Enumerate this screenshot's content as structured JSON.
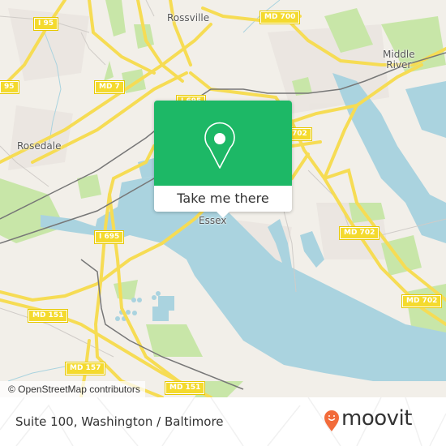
{
  "map": {
    "places": [
      {
        "name": "Rossville",
        "id": "rossville"
      },
      {
        "name": "Middle\nRiver",
        "id": "middle-river"
      },
      {
        "name": "Rosedale",
        "id": "rosedale"
      },
      {
        "name": "Essex",
        "id": "essex"
      }
    ],
    "road_shields": [
      {
        "label": "I 95",
        "id": "i95-north"
      },
      {
        "label": "95",
        "id": "i95-west"
      },
      {
        "label": "MD 7",
        "id": "md7"
      },
      {
        "label": "MD 700",
        "id": "md700"
      },
      {
        "label": "I 695",
        "id": "i695-top"
      },
      {
        "label": "702",
        "id": "md702-partial"
      },
      {
        "label": "I 695",
        "id": "i695"
      },
      {
        "label": "MD 702",
        "id": "md702-a"
      },
      {
        "label": "MD 702",
        "id": "md702-b"
      },
      {
        "label": "MD 151",
        "id": "md151-a"
      },
      {
        "label": "MD 157",
        "id": "md157"
      },
      {
        "label": "MD 151",
        "id": "md151-b"
      }
    ],
    "attribution": "© OpenStreetMap contributors",
    "colors": {
      "land": "#f2efe9",
      "water": "#aad3df",
      "park": "#c8e6a8",
      "road": "#f6dc54",
      "rail": "#777777",
      "popup_green": "#1db866",
      "brand_orange": "#f26b3a"
    }
  },
  "popup": {
    "icon": "location-pin-icon",
    "button_label": "Take me there"
  },
  "footer": {
    "title": "Suite 100, Washington / Baltimore",
    "brand": "moovit"
  }
}
